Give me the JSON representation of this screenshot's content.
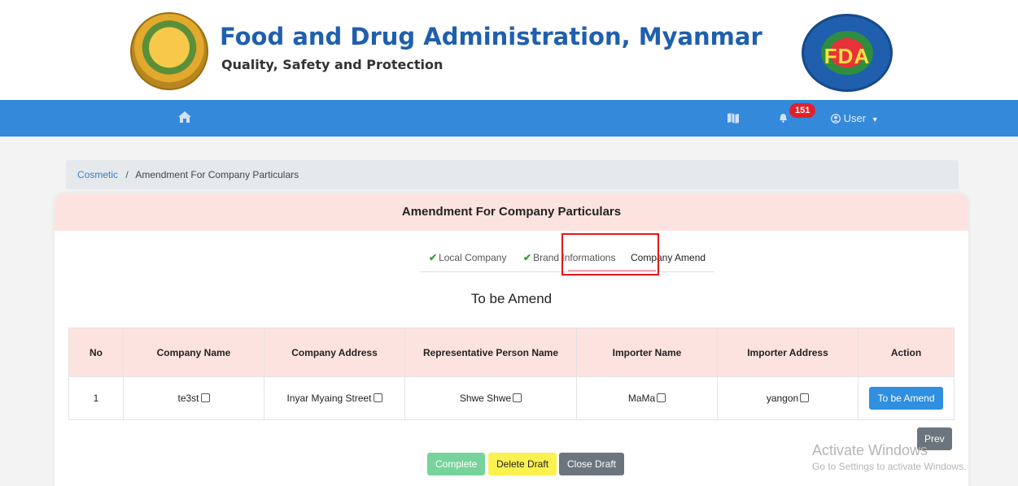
{
  "header": {
    "title": "Food and Drug Administration, Myanmar",
    "subtitle": "Quality, Safety and Protection",
    "right_logo_text": "FDA"
  },
  "nav": {
    "home_icon": "home-icon",
    "notification_count": "151",
    "user_label": "User"
  },
  "breadcrumb": {
    "root": "Cosmetic",
    "separator": "/",
    "current": "Amendment For Company Particulars"
  },
  "card": {
    "title": "Amendment For Company Particulars",
    "tabs": [
      {
        "label": "Local Company",
        "checked": true
      },
      {
        "label": "Brand Informations",
        "checked": true
      },
      {
        "label": "Company Amend",
        "active": true
      }
    ],
    "section_title": "To be Amend"
  },
  "table": {
    "headers": [
      "No",
      "Company Name",
      "Company Address",
      "Representative Person Name",
      "Importer Name",
      "Importer Address",
      "Action"
    ],
    "rows": [
      {
        "no": "1",
        "company_name": "te3st",
        "company_address": "Inyar Myaing Street",
        "rep_name": "Shwe Shwe",
        "importer_name": "MaMa",
        "importer_address": "yangon",
        "action": "To be Amend"
      }
    ]
  },
  "buttons": {
    "prev": "Prev",
    "complete": "Complete",
    "delete_draft": "Delete Draft",
    "close_draft": "Close Draft"
  },
  "watermark": {
    "line1": "Activate Windows",
    "line2": "Go to Settings to activate Windows."
  },
  "colors": {
    "navbar": "#3589db",
    "card_header": "#fde3df",
    "primary_button": "#2f8fe0",
    "badge": "#e0212c",
    "highlight_box": "#e01818"
  }
}
